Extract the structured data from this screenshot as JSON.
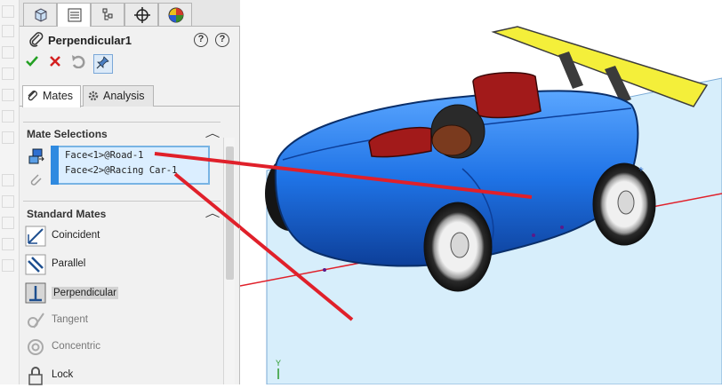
{
  "property_manager": {
    "feature_title": "Perpendicular1",
    "help_labels": [
      "?",
      "?"
    ],
    "tabs": [
      "Mates",
      "Analysis"
    ]
  },
  "mate_selections": {
    "header": "Mate Selections",
    "items": [
      "Face<1>@Road-1",
      "Face<2>@Racing Car-1"
    ]
  },
  "standard_mates": {
    "header": "Standard Mates",
    "items": [
      "Coincident",
      "Parallel",
      "Perpendicular",
      "Tangent",
      "Concentric",
      "Lock"
    ]
  },
  "viewport": {
    "axis_label": "Y"
  },
  "colors": {
    "selection_accent": "#2f8ae0",
    "car_body": "#1f73e6",
    "spoiler": "#f4ef3a",
    "seat": "#a21a1a",
    "road_plane": "#d7eefb",
    "annotation_line": "#e0202a"
  },
  "icons": {
    "panel_tabs": [
      "feature-manager-icon",
      "property-manager-icon",
      "configuration-manager-icon",
      "dimxpert-icon",
      "display-manager-icon"
    ],
    "actions": [
      "ok-check-icon",
      "cancel-x-icon",
      "undo-icon",
      "pushpin-icon"
    ]
  }
}
